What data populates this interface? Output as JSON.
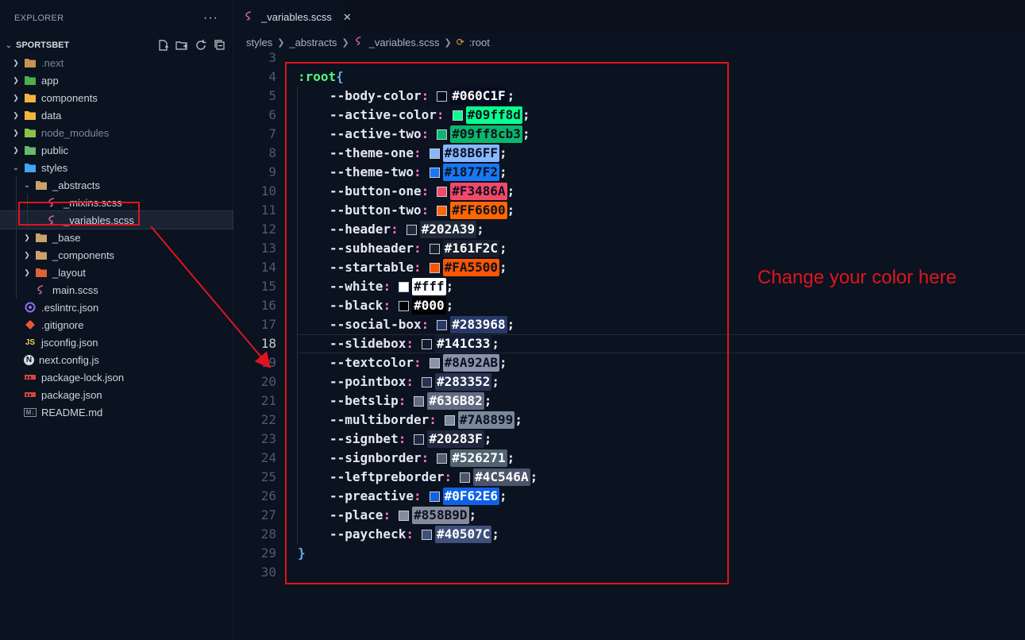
{
  "sidebar": {
    "title": "EXPLORER",
    "more": "···",
    "project": "SPORTSBET",
    "items": [
      {
        "label": ".next",
        "depth": 0,
        "chev": "›",
        "icon": "next-folder-icon",
        "color": "#c7934f",
        "dim": true
      },
      {
        "label": "app",
        "depth": 0,
        "chev": "›",
        "icon": "app-folder-icon",
        "color": "#4caf50"
      },
      {
        "label": "components",
        "depth": 0,
        "chev": "›",
        "icon": "components-folder-icon",
        "color": "#f4b53f"
      },
      {
        "label": "data",
        "depth": 0,
        "chev": "›",
        "icon": "data-folder-icon",
        "color": "#f4b53f"
      },
      {
        "label": "node_modules",
        "depth": 0,
        "chev": "›",
        "icon": "node-modules-folder-icon",
        "color": "#8bc34a",
        "dim": true
      },
      {
        "label": "public",
        "depth": 0,
        "chev": "›",
        "icon": "public-folder-icon",
        "color": "#66bb6a"
      },
      {
        "label": "styles",
        "depth": 0,
        "chev": "⌄",
        "icon": "styles-folder-icon",
        "color": "#42a5f5"
      },
      {
        "label": "_abstracts",
        "depth": 1,
        "chev": "⌄",
        "icon": "folder-open-icon",
        "color": "#c8a46a"
      },
      {
        "label": "_mixins.scss",
        "depth": 2,
        "chev": "",
        "icon": "sass-file-icon",
        "color": "#d3679a"
      },
      {
        "label": "_variables.scss",
        "depth": 2,
        "chev": "",
        "icon": "sass-file-icon",
        "color": "#d3679a",
        "selected": true
      },
      {
        "label": "_base",
        "depth": 1,
        "chev": "›",
        "icon": "folder-icon",
        "color": "#c8a46a"
      },
      {
        "label": "_components",
        "depth": 1,
        "chev": "›",
        "icon": "folder-icon",
        "color": "#c8a46a"
      },
      {
        "label": "_layout",
        "depth": 1,
        "chev": "›",
        "icon": "layout-folder-icon",
        "color": "#e0603a"
      },
      {
        "label": "main.scss",
        "depth": 1,
        "chev": "",
        "icon": "sass-file-icon",
        "color": "#d3679a"
      },
      {
        "label": ".eslintrc.json",
        "depth": 0,
        "chev": "",
        "icon": "eslint-file-icon",
        "color": "#8e6cf5"
      },
      {
        "label": ".gitignore",
        "depth": 0,
        "chev": "",
        "icon": "git-file-icon",
        "color": "#e8553d"
      },
      {
        "label": "jsconfig.json",
        "depth": 0,
        "chev": "",
        "icon": "js-file-icon",
        "color": "#f1d449",
        "glyph": "JS"
      },
      {
        "label": "next.config.js",
        "depth": 0,
        "chev": "",
        "icon": "next-file-icon",
        "color": "#d8dde6",
        "glyph": "N"
      },
      {
        "label": "package-lock.json",
        "depth": 0,
        "chev": "",
        "icon": "npm-file-icon",
        "color": "#d9453b"
      },
      {
        "label": "package.json",
        "depth": 0,
        "chev": "",
        "icon": "npm-file-icon",
        "color": "#d9453b"
      },
      {
        "label": "README.md",
        "depth": 0,
        "chev": "",
        "icon": "markdown-file-icon",
        "color": "#8a92a0",
        "glyph": "M↓"
      }
    ]
  },
  "editor": {
    "tab": {
      "label": "_variables.scss",
      "close": "✕"
    },
    "breadcrumb": [
      "styles",
      "_abstracts",
      "_variables.scss",
      ":root"
    ],
    "current_line": 18,
    "first_line": 3,
    "selector": ":root",
    "open_brace": "{",
    "close_brace": "}",
    "variables": [
      {
        "line": 5,
        "name": "--body-color",
        "value": "#060C1F",
        "color": "#060C1F",
        "text": "#ffffff"
      },
      {
        "line": 6,
        "name": "--active-color",
        "value": "#09ff8d",
        "color": "#09ff8d",
        "text": "#0b1220"
      },
      {
        "line": 7,
        "name": "--active-two",
        "value": "#09ff8cb3",
        "color": "#09ff8cb3",
        "text": "#0b1220"
      },
      {
        "line": 8,
        "name": "--theme-one",
        "value": "#88B6FF",
        "color": "#88B6FF",
        "text": "#0b1220"
      },
      {
        "line": 9,
        "name": "--theme-two",
        "value": "#1877F2",
        "color": "#1877F2",
        "text": "#0b1220"
      },
      {
        "line": 10,
        "name": "--button-one",
        "value": "#F3486A",
        "color": "#F3486A",
        "text": "#0b1220"
      },
      {
        "line": 11,
        "name": "--button-two",
        "value": "#FF6600",
        "color": "#FF6600",
        "text": "#0b1220"
      },
      {
        "line": 12,
        "name": "--header",
        "value": "#202A39",
        "color": "#202A39",
        "text": "#ffffff"
      },
      {
        "line": 13,
        "name": "--subheader",
        "value": "#161F2C",
        "color": "#161F2C",
        "text": "#ffffff"
      },
      {
        "line": 14,
        "name": "--startable",
        "value": "#FA5500",
        "color": "#FA5500",
        "text": "#0b1220"
      },
      {
        "line": 15,
        "name": "--white",
        "value": "#fff",
        "color": "#ffffff",
        "text": "#0b1220"
      },
      {
        "line": 16,
        "name": "--black",
        "value": "#000",
        "color": "#000000",
        "text": "#ffffff"
      },
      {
        "line": 17,
        "name": "--social-box",
        "value": "#283968",
        "color": "#283968",
        "text": "#ffffff"
      },
      {
        "line": 18,
        "name": "--slidebox",
        "value": "#141C33",
        "color": "#141C33",
        "text": "#ffffff"
      },
      {
        "line": 19,
        "name": "--textcolor",
        "value": "#8A92AB",
        "color": "#8A92AB",
        "text": "#0b1220"
      },
      {
        "line": 20,
        "name": "--pointbox",
        "value": "#283352",
        "color": "#283352",
        "text": "#ffffff"
      },
      {
        "line": 21,
        "name": "--betslip",
        "value": "#636B82",
        "color": "#636B82",
        "text": "#ffffff"
      },
      {
        "line": 22,
        "name": "--multiborder",
        "value": "#7A8899",
        "color": "#7A8899",
        "text": "#0b1220"
      },
      {
        "line": 23,
        "name": "--signbet",
        "value": "#20283F",
        "color": "#20283F",
        "text": "#ffffff"
      },
      {
        "line": 24,
        "name": "--signborder",
        "value": "#526271",
        "color": "#526271",
        "text": "#ffffff"
      },
      {
        "line": 25,
        "name": "--leftpreborder",
        "value": "#4C546A",
        "color": "#4C546A",
        "text": "#ffffff"
      },
      {
        "line": 26,
        "name": "--preactive",
        "value": "#0F62E6",
        "color": "#0F62E6",
        "text": "#ffffff"
      },
      {
        "line": 27,
        "name": "--place",
        "value": "#858B9D",
        "color": "#858B9D",
        "text": "#0b1220"
      },
      {
        "line": 28,
        "name": "--paycheck",
        "value": "#40507C",
        "color": "#40507C",
        "text": "#ffffff"
      }
    ]
  },
  "annotation": {
    "text": "Change your color here",
    "color": "#e0141e"
  }
}
